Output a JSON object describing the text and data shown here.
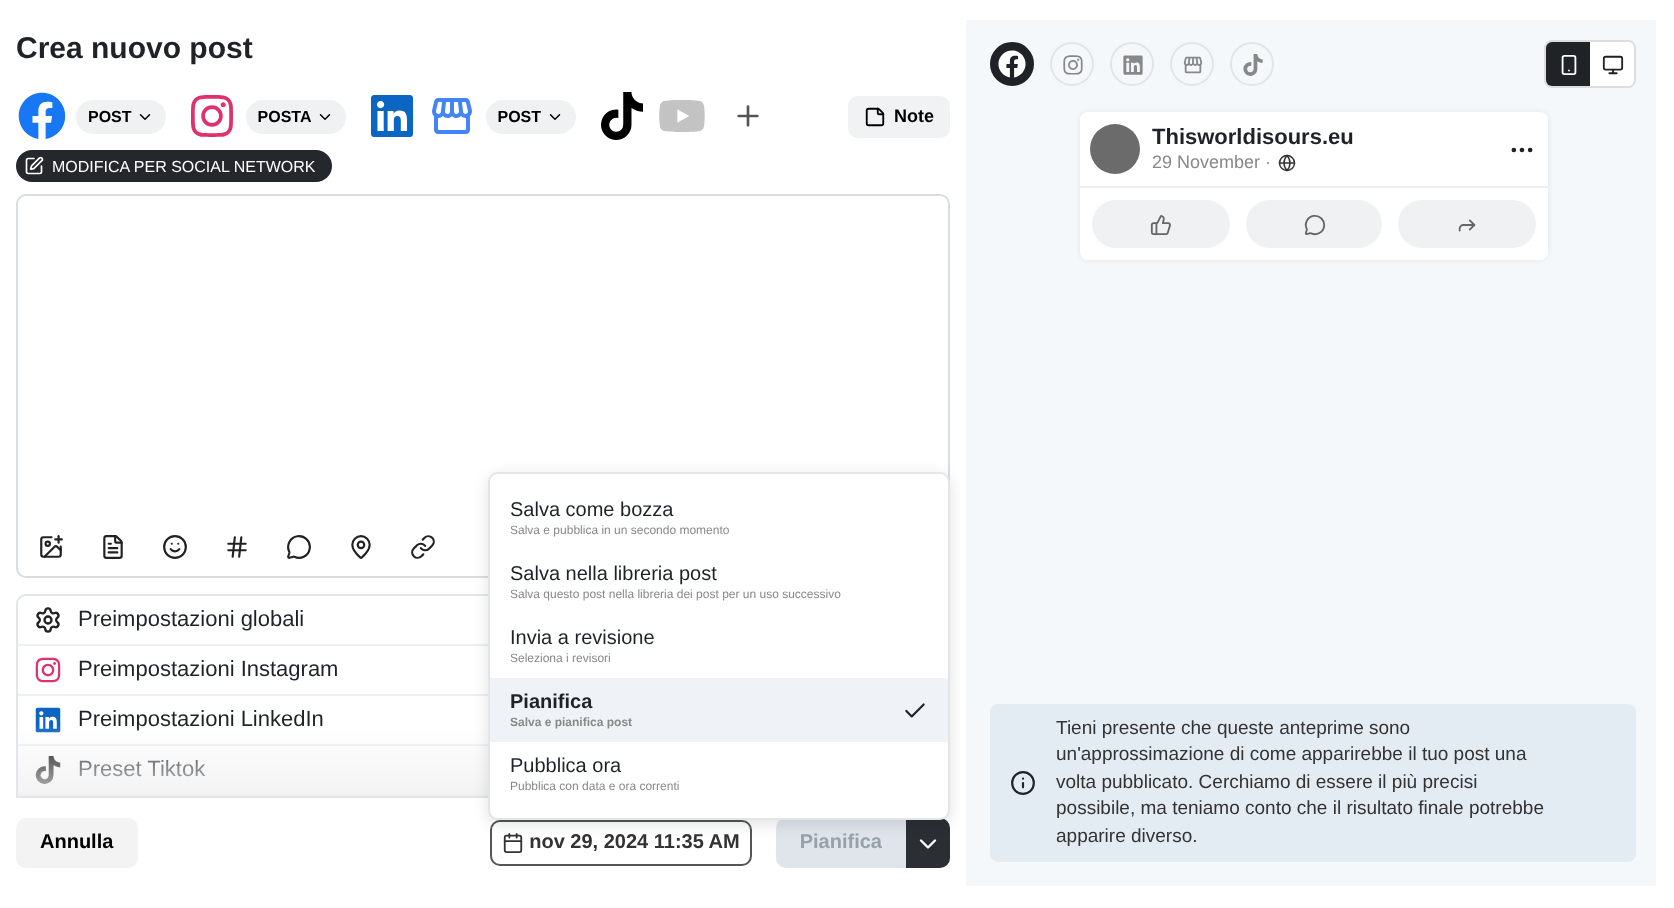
{
  "title": "Crea nuovo post",
  "networks": [
    {
      "kind": "facebook",
      "post_type": "POST",
      "disabled": false
    },
    {
      "kind": "instagram",
      "post_type": "POSTA",
      "disabled": false
    },
    {
      "kind": "linkedin",
      "disabled": false
    },
    {
      "kind": "business",
      "post_type": "POST",
      "disabled": false
    },
    {
      "kind": "tiktok",
      "disabled": false
    },
    {
      "kind": "youtube",
      "disabled": true
    }
  ],
  "note_button": "Note",
  "edit_badge": "MODIFICA PER SOCIAL NETWORK",
  "presets": [
    {
      "kind": "global",
      "label": "Preimpostazioni globali"
    },
    {
      "kind": "instagram",
      "label": "Preimpostazioni Instagram"
    },
    {
      "kind": "linkedin",
      "label": "Preimpostazioni LinkedIn"
    },
    {
      "kind": "tiktok",
      "label": "Preset Tiktok"
    }
  ],
  "menu": [
    {
      "title": "Salva come bozza",
      "subtitle": "Salva e pubblica in un secondo momento",
      "selected": false
    },
    {
      "title": "Salva nella libreria post",
      "subtitle": "Salva questo post nella libreria dei post per un uso successivo",
      "selected": false
    },
    {
      "title": "Invia a revisione",
      "subtitle": "Seleziona i revisori",
      "selected": false
    },
    {
      "title": "Pianifica",
      "subtitle": "Salva e pianifica post",
      "selected": true
    },
    {
      "title": "Pubblica ora",
      "subtitle": "Pubblica con data e ora correnti",
      "selected": false
    }
  ],
  "footer": {
    "cancel": "Annulla",
    "date": "nov 29, 2024 11:35 AM",
    "submit": "Pianifica"
  },
  "preview": {
    "tabs": [
      {
        "kind": "facebook",
        "selected": true
      },
      {
        "kind": "instagram",
        "selected": false
      },
      {
        "kind": "linkedin",
        "selected": false
      },
      {
        "kind": "business",
        "selected": false
      },
      {
        "kind": "tiktok",
        "selected": false
      }
    ],
    "devices": [
      {
        "kind": "mobile",
        "selected": true
      },
      {
        "kind": "desktop",
        "selected": false
      }
    ],
    "post": {
      "account": "Thisworldisours.eu",
      "date": "29 November ·"
    },
    "notice": "Tieni presente che queste anteprime sono un'approssimazione di come apparirebbe il tuo post una volta pubblicato. Cerchiamo di essere il più precisi possibile, ma teniamo conto che il risultato finale potrebbe apparire diverso."
  }
}
